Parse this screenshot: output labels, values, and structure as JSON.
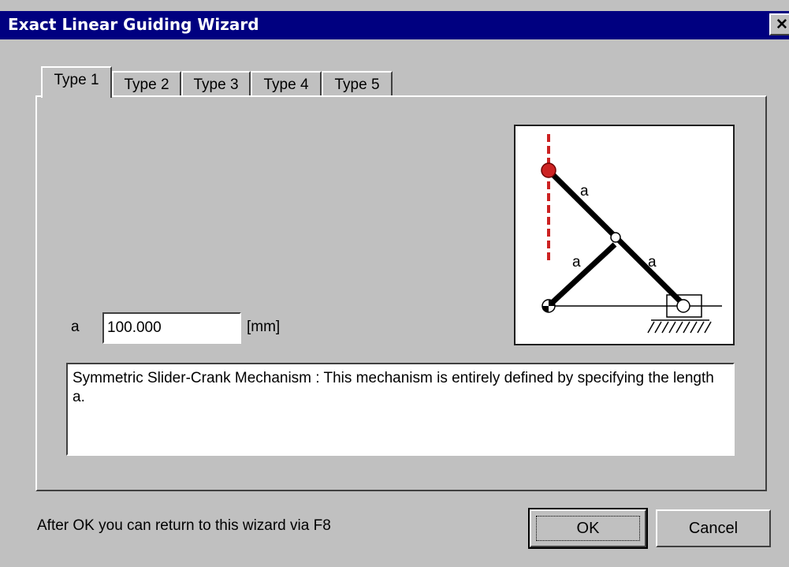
{
  "window": {
    "title": "Exact Linear Guiding Wizard",
    "close_glyph": "✕"
  },
  "tabs": [
    {
      "label": "Type 1",
      "active": true
    },
    {
      "label": "Type 2",
      "active": false
    },
    {
      "label": "Type 3",
      "active": false
    },
    {
      "label": "Type 4",
      "active": false
    },
    {
      "label": "Type 5",
      "active": false
    }
  ],
  "param": {
    "label": "a",
    "value": "100.000",
    "unit": "[mm]"
  },
  "diagram": {
    "link_labels": [
      "a",
      "a",
      "a"
    ],
    "colors": {
      "guide_line": "#cc2222",
      "joint_point": "#cc2222",
      "links": "#000000"
    }
  },
  "description": "Symmetric Slider-Crank Mechanism : This mechanism is entirely defined by specifying the length a.",
  "footer": {
    "hint": "After OK you can return to this wizard via F8",
    "ok_label": "OK",
    "cancel_label": "Cancel"
  }
}
